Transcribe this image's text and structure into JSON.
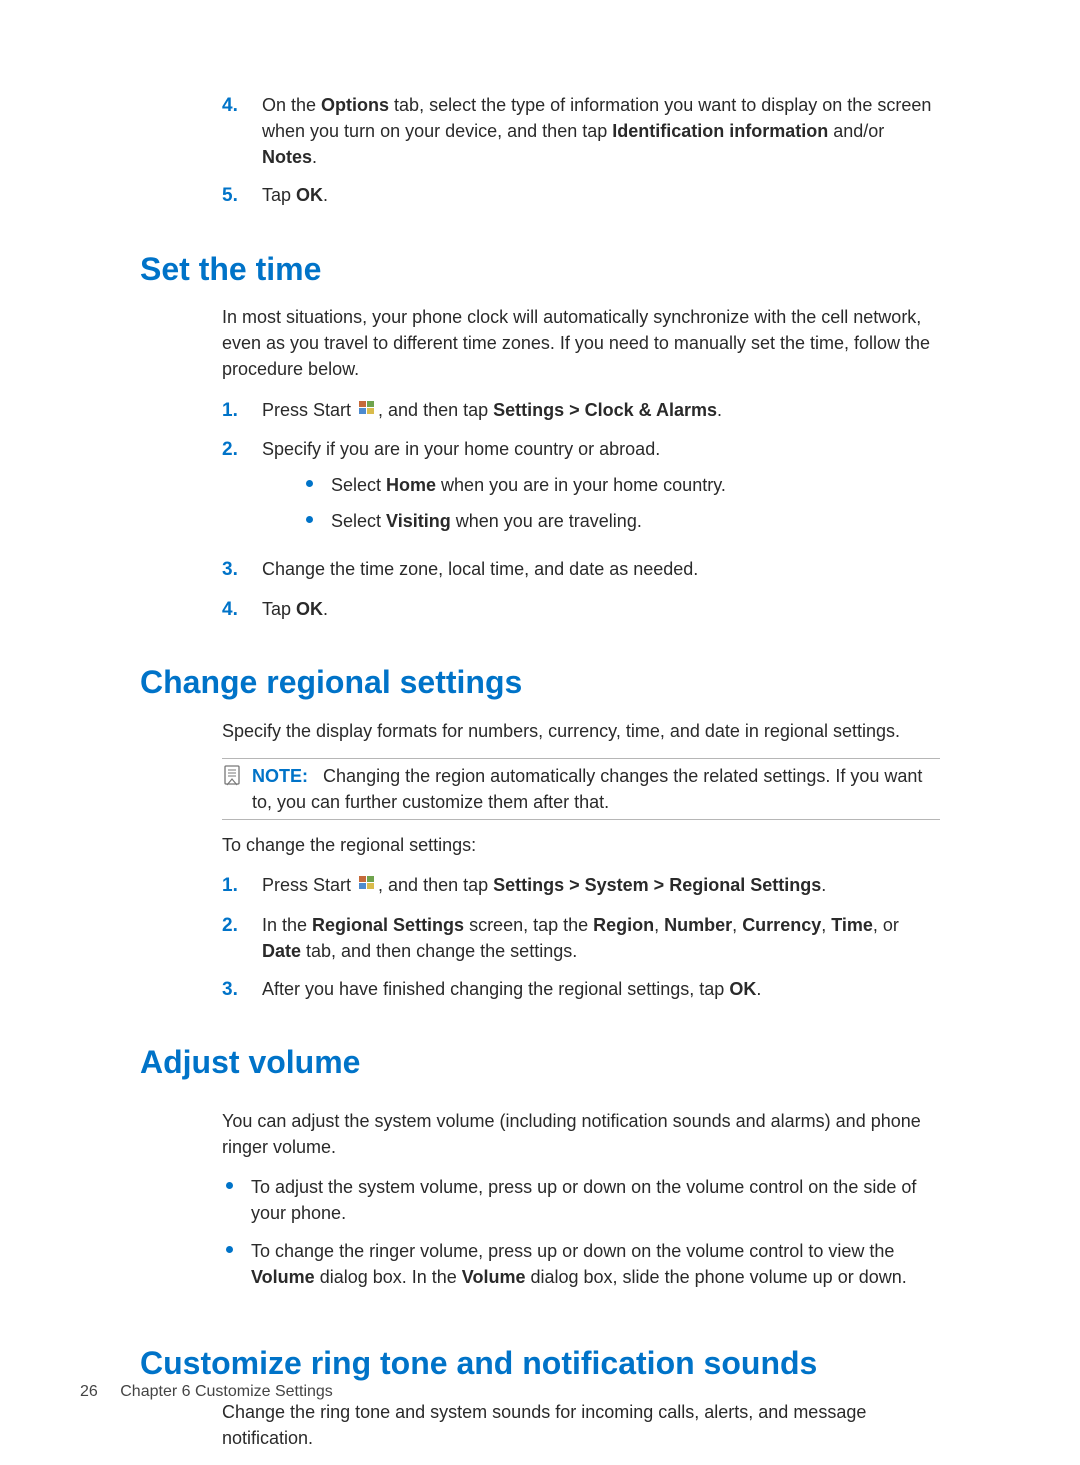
{
  "top_steps": {
    "s4_num": "4.",
    "s4_a": "On the ",
    "s4_b_options": "Options",
    "s4_c": " tab, select the type of information you want to display on the screen when you turn on your device, and then tap ",
    "s4_b_idinfo": "Identification information",
    "s4_d": " and/or ",
    "s4_b_notes": "Notes",
    "s4_e": ".",
    "s5_num": "5.",
    "s5_a": "Tap ",
    "s5_b_ok": "OK",
    "s5_c": "."
  },
  "section_time": {
    "heading": "Set the time",
    "intro": "In most situations, your phone clock will automatically synchronize with the cell network, even as you travel to different time zones. If you need to manually set the time, follow the procedure below.",
    "s1_num": "1.",
    "s1_a": "Press Start ",
    "s1_b": ", and then tap ",
    "s1_bold": "Settings > Clock & Alarms",
    "s1_c": ".",
    "s2_num": "2.",
    "s2_a": "Specify if you are in your home country or abroad.",
    "s2_bullet1_a": "Select ",
    "s2_bullet1_b": "Home",
    "s2_bullet1_c": " when you are in your home country.",
    "s2_bullet2_a": "Select ",
    "s2_bullet2_b": "Visiting",
    "s2_bullet2_c": " when you are traveling.",
    "s3_num": "3.",
    "s3_a": "Change the time zone, local time, and date as needed.",
    "s4_num": "4.",
    "s4_a": "Tap ",
    "s4_b": "OK",
    "s4_c": "."
  },
  "section_regional": {
    "heading": "Change regional settings",
    "intro": "Specify the display formats for numbers, currency, time, and date in regional settings.",
    "note_label": "NOTE:",
    "note_text": "Changing the region automatically changes the related settings. If you want to, you can further customize them after that.",
    "lead": "To change the regional settings:",
    "s1_num": "1.",
    "s1_a": "Press Start ",
    "s1_b": ", and then tap ",
    "s1_bold": "Settings > System > Regional Settings",
    "s1_c": ".",
    "s2_num": "2.",
    "s2_a": "In the ",
    "s2_b1": "Regional Settings",
    "s2_c": " screen, tap the ",
    "s2_b2": "Region",
    "s2_comma1": ", ",
    "s2_b3": "Number",
    "s2_comma2": ", ",
    "s2_b4": "Currency",
    "s2_comma3": ", ",
    "s2_b5": "Time",
    "s2_or": ", or ",
    "s2_b6": "Date",
    "s2_d": " tab, and then change the settings.",
    "s3_num": "3.",
    "s3_a": "After you have finished changing the regional settings, tap ",
    "s3_b": "OK",
    "s3_c": "."
  },
  "section_volume": {
    "heading": "Adjust volume",
    "intro": "You can adjust the system volume (including notification sounds and alarms) and phone ringer volume.",
    "b1": "To adjust the system volume, press up or down on the volume control on the side of your phone.",
    "b2_a": "To change the ringer volume, press up or down on the volume control to view the ",
    "b2_b": "Volume",
    "b2_c": " dialog box. In the ",
    "b2_d": "Volume",
    "b2_e": " dialog box, slide the phone volume up or down."
  },
  "section_ring": {
    "heading": "Customize ring tone and notification sounds",
    "intro": "Change the ring tone and system sounds for incoming calls, alerts, and message notification."
  },
  "footer": {
    "page_number": "26",
    "chapter": "Chapter 6   Customize Settings"
  }
}
